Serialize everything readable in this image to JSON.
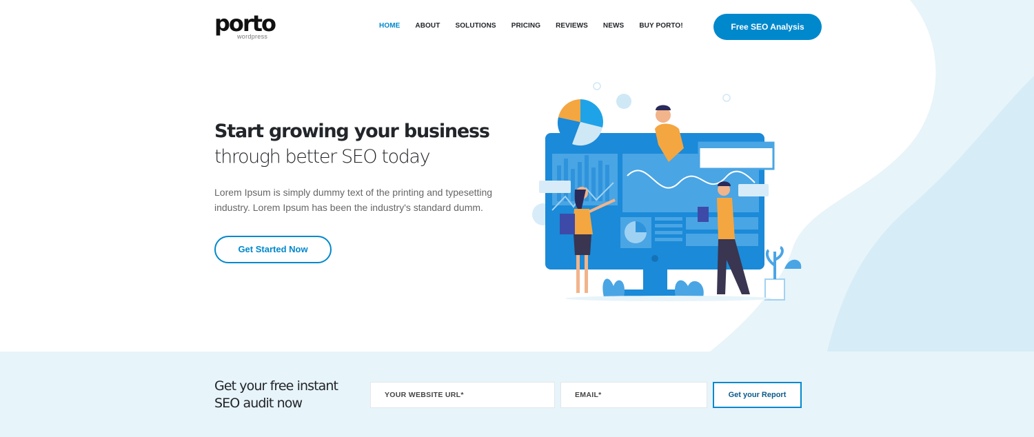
{
  "header": {
    "logo": {
      "name": "porto",
      "sub": "wordpress"
    },
    "nav": [
      {
        "label": "HOME",
        "active": true
      },
      {
        "label": "ABOUT",
        "active": false
      },
      {
        "label": "SOLUTIONS",
        "active": false
      },
      {
        "label": "PRICING",
        "active": false
      },
      {
        "label": "REVIEWS",
        "active": false
      },
      {
        "label": "NEWS",
        "active": false
      },
      {
        "label": "BUY PORTO!",
        "active": false
      }
    ],
    "cta_label": "Free SEO Analysis"
  },
  "hero": {
    "title": "Start growing your business",
    "subtitle": "through better SEO today",
    "description": "Lorem Ipsum is simply dummy text of the printing and typesetting industry. Lorem Ipsum has been the industry's standard dumm.",
    "button_label": "Get Started Now",
    "illustration": "seo-analytics-illustration"
  },
  "audit": {
    "title_line1": "Get your free instant",
    "title_line2": "SEO audit now",
    "url_placeholder": "YOUR WEBSITE URL*",
    "email_placeholder": "EMAIL*",
    "button_label": "Get your Report"
  },
  "colors": {
    "primary": "#0088cc",
    "band_background": "#e7f4fa",
    "text_dark": "#222529"
  }
}
